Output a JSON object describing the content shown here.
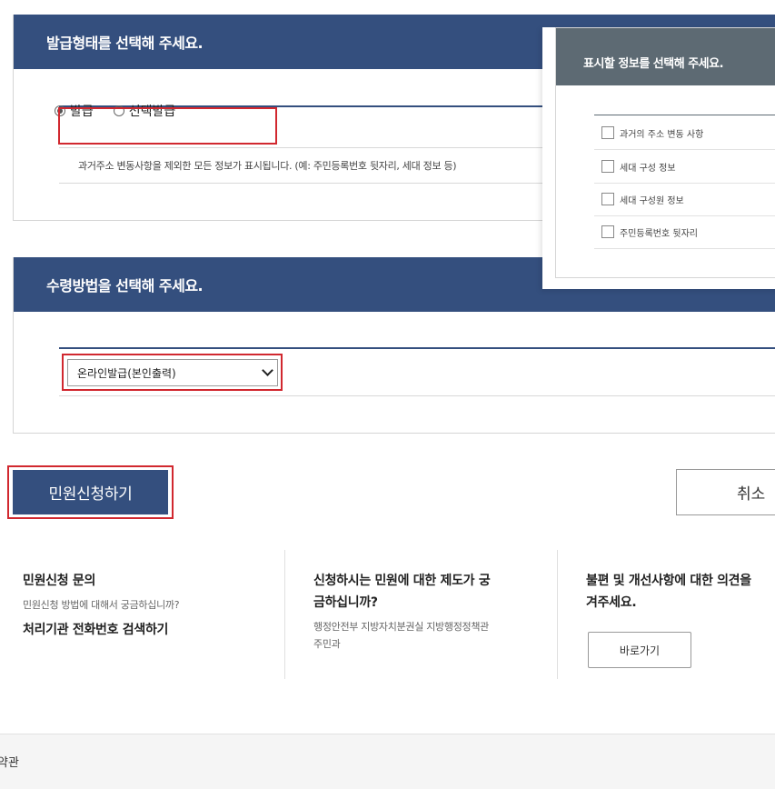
{
  "issue_type": {
    "title": "발급형태를 선택해 주세요.",
    "options": [
      "발급",
      "선택발급"
    ],
    "selected": "발급",
    "description": "과거주소 변동사항을 제외한 모든 정보가 표시됩니다. (예: 주민등록번호 뒷자리, 세대 정보 등)"
  },
  "info_panel": {
    "title": "표시할 정보를 선택해 주세요.",
    "items": [
      "과거의 주소 변동 사항",
      "세대 구성 정보",
      "세대 구성원 정보",
      "주민등록번호 뒷자리"
    ]
  },
  "receive_method": {
    "title": "수령방법을 선택해 주세요.",
    "selected": "온라인발급(본인출력)"
  },
  "actions": {
    "submit_label": "민원신청하기",
    "cancel_label": "취소"
  },
  "info": {
    "col1": {
      "title": "민원신청 문의",
      "subtitle": "민원신청 방법에 대해서 궁금하십니까?",
      "link": "처리기관 전화번호 검색하기"
    },
    "col2": {
      "title_line1": "신청하시는 민원에 대한 제도가 궁",
      "title_line2": "금하십니까?",
      "sub_line1": "행정안전부 지방자치분권실 지방행정정책관",
      "sub_line2": "주민과"
    },
    "col3": {
      "title_line1": "불편 및 개선사항에 대한 의견을",
      "title_line2": "겨주세요.",
      "button": "바로가기"
    }
  },
  "footer": {
    "text": "약관"
  }
}
